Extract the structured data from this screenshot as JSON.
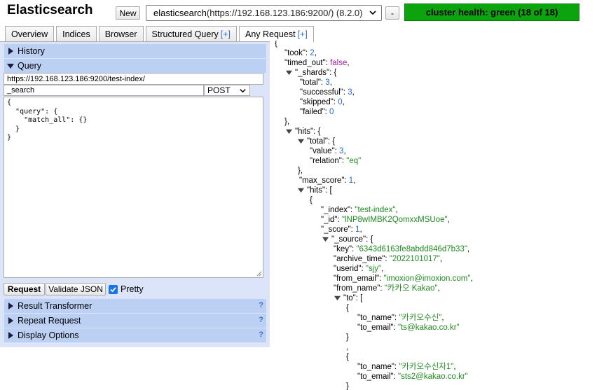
{
  "header": {
    "app_title": "Elasticsearch",
    "new_label": "New",
    "connection_label": "elasticsearch",
    "connection_detail": " (https://192.168.123.186:9200/) (8.2.0)",
    "remove_label": "-",
    "cluster_health": "cluster health: green (18 of 18)",
    "health_color": "#0ca40c"
  },
  "tabs": [
    {
      "label": "Overview",
      "plus": ""
    },
    {
      "label": "Indices",
      "plus": ""
    },
    {
      "label": "Browser",
      "plus": ""
    },
    {
      "label": "Structured Query ",
      "plus": "[+]"
    },
    {
      "label": "Any Request ",
      "plus": "[+]"
    }
  ],
  "left": {
    "history_label": "History",
    "query_label": "Query",
    "url_value": "https://192.168.123.186:9200/test-index/",
    "path_value": "_search",
    "method_value": "POST",
    "body_value": "{\n  \"query\": {\n    \"match_all\": {}\n  }\n}",
    "request_label": "Request",
    "validate_label": "Validate JSON",
    "pretty_label": "Pretty",
    "result_transformer_label": "Result Transformer",
    "repeat_request_label": "Repeat Request",
    "display_options_label": "Display Options",
    "help_mark": "?"
  },
  "response": {
    "l0": "{",
    "took_key": "\"took\": ",
    "took_val": "2",
    "took_end": ",",
    "timed_key": "\"timed_out\": ",
    "timed_val": "false",
    "timed_end": ",",
    "shards_key": "\"_shards\": {",
    "total_key": "\"total\": ",
    "total_val": "3",
    "total_end": ",",
    "successful_key": "\"successful\": ",
    "successful_val": "3",
    "successful_end": ",",
    "skipped_key": "\"skipped\": ",
    "skipped_val": "0",
    "skipped_end": ",",
    "failed_key": "\"failed\": ",
    "failed_val": "0",
    "shards_close": "},",
    "hits_key": "\"hits\": {",
    "htotal_key": "\"total\": {",
    "value_key": "\"value\": ",
    "value_val": "3",
    "value_end": ",",
    "relation_key": "\"relation\": ",
    "relation_val": "\"eq\"",
    "htotal_close": "},",
    "maxscore_key": "\"max_score\": ",
    "maxscore_val": "1",
    "maxscore_end": ",",
    "hitsarr_key": "\"hits\": [",
    "obj_open": "{",
    "index_key": "\"_index\": ",
    "index_val": "\"test-index\"",
    "index_end": ",",
    "id_key": "\"_id\": ",
    "id_val": "\"lNP8wIMBK2QomxxMSUoe\"",
    "id_end": ",",
    "score_key": "\"_score\": ",
    "score_val": "1",
    "score_end": ",",
    "source_key": "\"_source\": {",
    "key_key": "\"key\": ",
    "key_val": "\"6343d6163fe8abdd846d7b33\"",
    "key_end": ",",
    "archive_key": "\"archive_time\": ",
    "archive_val": "\"2022101017\"",
    "archive_end": ",",
    "userid_key": "\"userid\": ",
    "userid_val": "\"sjy\"",
    "userid_end": ",",
    "fromemail_key": "\"from_email\": ",
    "fromemail_val": "\"imoxion@imoxion.com\"",
    "fromemail_end": ",",
    "fromname_key": "\"from_name\": ",
    "fromname_val": "\"카카오 Kakao\"",
    "fromname_end": ",",
    "to_key": "\"to\": [",
    "to1_open": "{",
    "to1_name_key": "\"to_name\": ",
    "to1_name_val": "\"카카오수신\"",
    "to1_name_end": ",",
    "to1_email_key": "\"to_email\": ",
    "to1_email_val": "\"ts@kakao.co.kr\"",
    "to1_close": "}",
    "comma": ",",
    "to2_open": "{",
    "to2_name_key": "\"to_name\": ",
    "to2_name_val": "\"카카오수신자1\"",
    "to2_name_end": ",",
    "to2_email_key": "\"to_email\": ",
    "to2_email_val": "\"sts2@kakao.co.kr\"",
    "to2_close": "}"
  },
  "colors": {
    "panel_bg": "#dbe4f8",
    "section_header": "#bcd0f3",
    "string": "#1f8a1f",
    "number": "#1f6bd8",
    "boolean": "#a01ba0",
    "link_plus": "#3a6fd8"
  },
  "icons": {
    "collapsed": "triangle-right-icon",
    "expanded": "triangle-down-icon",
    "dropdown": "chevron-down-icon",
    "check": "check-icon"
  }
}
